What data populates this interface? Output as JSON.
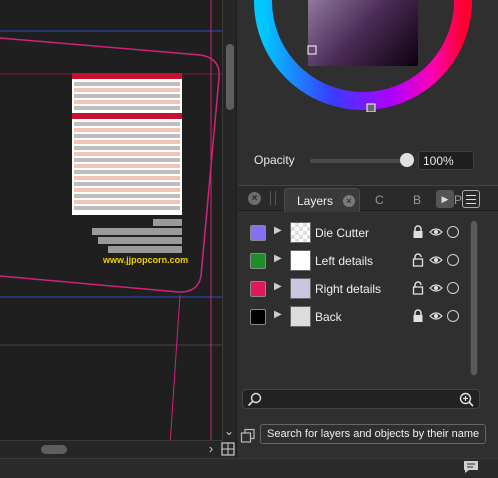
{
  "canvas": {
    "url_text": "www.jjpopcorn.com",
    "colors": {
      "background": "#1f1f1f",
      "pink_guide": "#d0237a",
      "blue_guide": "#2b4bd6",
      "red_band": "#c8102e",
      "url_yellow": "#f0d000"
    }
  },
  "color_panel": {
    "opacity_label": "Opacity",
    "opacity_value": "100%",
    "opacity_level": 1.0
  },
  "tabs": {
    "layers_label": "Layers",
    "other_tabs": [
      "C",
      "B",
      "P"
    ],
    "more_icon": "play-icon",
    "menu_icon": "hamburger-icon"
  },
  "layers": [
    {
      "name": "Die Cutter",
      "swatch": "#8370f5",
      "lock_state": "locked",
      "visible": true
    },
    {
      "name": "Left details",
      "swatch": "#1f8b2a",
      "lock_state": "unlocked",
      "visible": true
    },
    {
      "name": "Right details",
      "swatch": "#e0195e",
      "lock_state": "unlocked",
      "visible": true
    },
    {
      "name": "Back",
      "swatch": "#000000",
      "lock_state": "locked",
      "visible": true
    }
  ],
  "search": {
    "tooltip": "Search for layers and objects by their name"
  }
}
